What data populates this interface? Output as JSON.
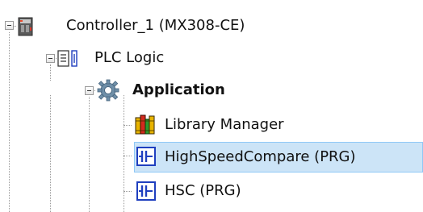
{
  "tree": {
    "items": [
      {
        "label": "Controller_1 (MX308-CE)",
        "icon": "controller-icon",
        "expanded": true
      },
      {
        "label": "PLC Logic",
        "icon": "plc-logic-icon",
        "expanded": true
      },
      {
        "label": "Application",
        "icon": "application-gear-icon",
        "expanded": true
      },
      {
        "label": "Library Manager",
        "icon": "library-books-icon"
      },
      {
        "label": "HighSpeedCompare (PRG)",
        "icon": "program-pou-icon",
        "selected": true
      },
      {
        "label": "HSC (PRG)",
        "icon": "program-pou-icon"
      }
    ]
  },
  "colors": {
    "selection_background": "#cce4f7",
    "selection_border": "#90c8f6",
    "connector_lines": "#9a9a9a"
  }
}
